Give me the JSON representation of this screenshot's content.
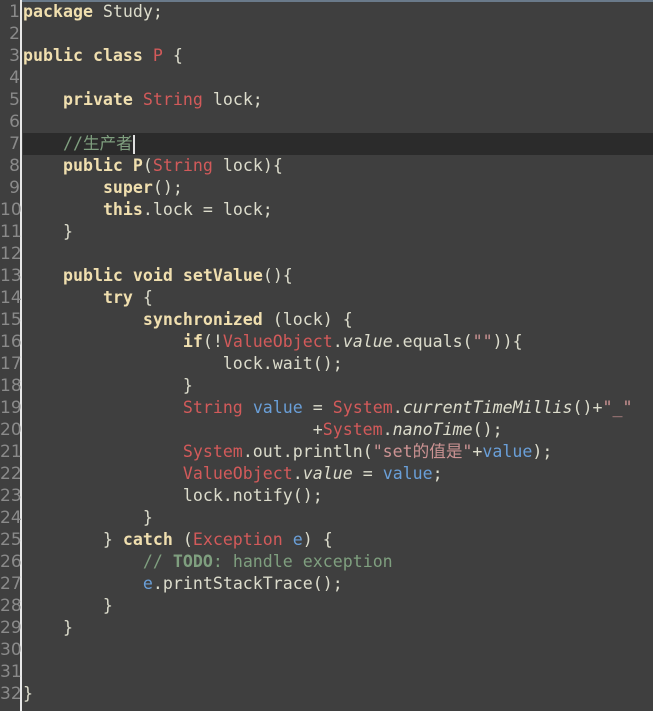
{
  "editor": {
    "theme_colors": {
      "background": "#3f3f3f",
      "keyword": "#f0dfaf",
      "type": "#d25a5a",
      "variable": "#6a9fd8",
      "string": "#cc9393",
      "comment": "#7f9f7f",
      "text": "#dcdccc",
      "current_line": "#2b2b2b"
    },
    "current_line": 7,
    "lines": [
      [
        [
          "package",
          "k"
        ],
        [
          " Study;",
          ""
        ]
      ],
      [],
      [
        [
          "public",
          "k"
        ],
        [
          " ",
          ""
        ],
        [
          "class",
          "k"
        ],
        [
          " ",
          ""
        ],
        [
          "P",
          "t"
        ],
        [
          " {",
          ""
        ]
      ],
      [],
      [
        [
          "    ",
          ""
        ],
        [
          "private",
          "k"
        ],
        [
          " ",
          ""
        ],
        [
          "String",
          "t"
        ],
        [
          " lock;",
          ""
        ]
      ],
      [],
      [
        [
          "    ",
          ""
        ],
        [
          "//生产者",
          "c"
        ]
      ],
      [
        [
          "    ",
          ""
        ],
        [
          "public",
          "k"
        ],
        [
          " ",
          ""
        ],
        [
          "P",
          "k"
        ],
        [
          "(",
          ""
        ],
        [
          "String",
          "t"
        ],
        [
          " lock){",
          ""
        ]
      ],
      [
        [
          "        ",
          ""
        ],
        [
          "super",
          "k"
        ],
        [
          "();",
          ""
        ]
      ],
      [
        [
          "        ",
          ""
        ],
        [
          "this",
          "k"
        ],
        [
          ".lock = lock;",
          ""
        ]
      ],
      [
        [
          "    }",
          ""
        ]
      ],
      [],
      [
        [
          "    ",
          ""
        ],
        [
          "public",
          "k"
        ],
        [
          " ",
          ""
        ],
        [
          "void",
          "k"
        ],
        [
          " ",
          ""
        ],
        [
          "setValue",
          "k"
        ],
        [
          "(){",
          ""
        ]
      ],
      [
        [
          "        ",
          ""
        ],
        [
          "try",
          "k"
        ],
        [
          " {",
          ""
        ]
      ],
      [
        [
          "            ",
          ""
        ],
        [
          "synchronized",
          "k"
        ],
        [
          " (lock) {",
          ""
        ]
      ],
      [
        [
          "                ",
          ""
        ],
        [
          "if",
          "k"
        ],
        [
          "(!",
          ""
        ],
        [
          "ValueObject",
          "t"
        ],
        [
          ".",
          ""
        ],
        [
          "value",
          "i"
        ],
        [
          ".equals(",
          ""
        ],
        [
          "\"\"",
          "s"
        ],
        [
          ")){",
          ""
        ]
      ],
      [
        [
          "                    lock.wait();",
          ""
        ]
      ],
      [
        [
          "                }",
          ""
        ]
      ],
      [
        [
          "                ",
          ""
        ],
        [
          "String",
          "t"
        ],
        [
          " ",
          ""
        ],
        [
          "value",
          "v"
        ],
        [
          " = ",
          ""
        ],
        [
          "System",
          "t"
        ],
        [
          ".",
          ""
        ],
        [
          "currentTimeMillis",
          "i"
        ],
        [
          "()+",
          ""
        ],
        [
          "\"_\"",
          "s"
        ]
      ],
      [
        [
          "                             +",
          ""
        ],
        [
          "System",
          "t"
        ],
        [
          ".",
          ""
        ],
        [
          "nanoTime",
          "i"
        ],
        [
          "();",
          ""
        ]
      ],
      [
        [
          "                ",
          ""
        ],
        [
          "System",
          "t"
        ],
        [
          ".out.println(",
          ""
        ],
        [
          "\"set的值是\"",
          "s"
        ],
        [
          "+",
          ""
        ],
        [
          "value",
          "v"
        ],
        [
          ");",
          ""
        ]
      ],
      [
        [
          "                ",
          ""
        ],
        [
          "ValueObject",
          "t"
        ],
        [
          ".",
          ""
        ],
        [
          "value",
          "i"
        ],
        [
          " = ",
          ""
        ],
        [
          "value",
          "v"
        ],
        [
          ";",
          ""
        ]
      ],
      [
        [
          "                lock.notify();",
          ""
        ]
      ],
      [
        [
          "            }",
          ""
        ]
      ],
      [
        [
          "        } ",
          ""
        ],
        [
          "catch",
          "k"
        ],
        [
          " (",
          ""
        ],
        [
          "Exception",
          "t"
        ],
        [
          " ",
          ""
        ],
        [
          "e",
          "v"
        ],
        [
          ") {",
          ""
        ]
      ],
      [
        [
          "            ",
          ""
        ],
        [
          "// ",
          "c"
        ],
        [
          "TODO",
          "cb"
        ],
        [
          ": handle exception",
          "c"
        ]
      ],
      [
        [
          "            ",
          ""
        ],
        [
          "e",
          "v"
        ],
        [
          ".printStackTrace();",
          ""
        ]
      ],
      [
        [
          "        }",
          ""
        ]
      ],
      [
        [
          "    }",
          ""
        ]
      ],
      [],
      [],
      [
        [
          "}",
          ""
        ]
      ]
    ]
  }
}
